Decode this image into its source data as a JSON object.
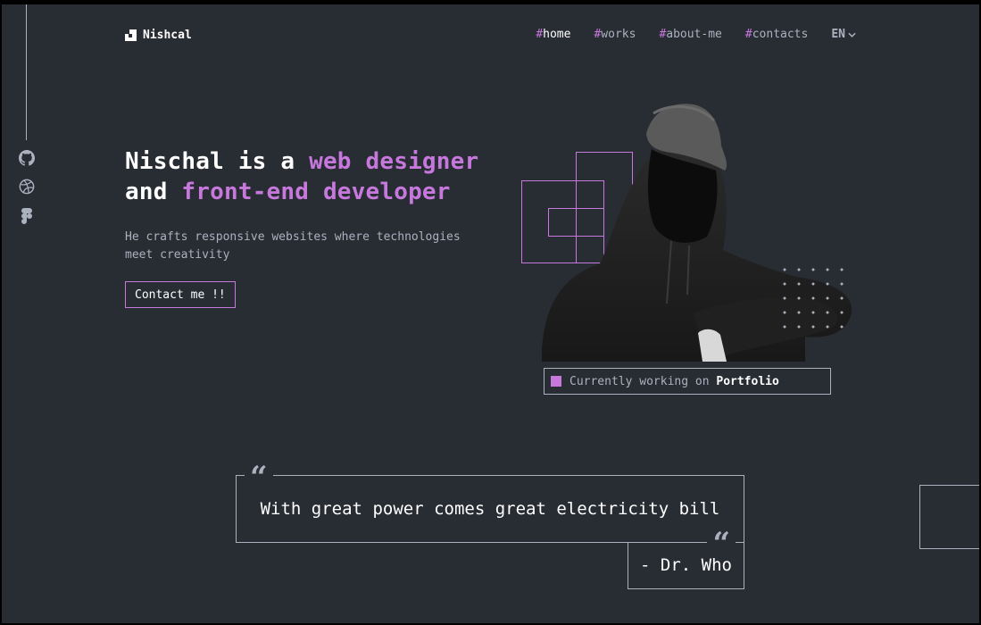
{
  "header": {
    "logo_name": "Nishcal",
    "nav": [
      {
        "hash": "#",
        "label": "home",
        "active": true
      },
      {
        "hash": "#",
        "label": "works"
      },
      {
        "hash": "#",
        "label": "about-me"
      },
      {
        "hash": "#",
        "label": "contacts"
      }
    ],
    "language": "EN"
  },
  "sidebar": {
    "socials": [
      "github-icon",
      "dribbble-icon",
      "figma-icon"
    ]
  },
  "hero": {
    "line1_plain": "Nischal is a ",
    "line1_accent": "web designer",
    "line2_plain": "and ",
    "line2_accent": "front-end developer",
    "subtitle": "He crafts responsive websites where technologies meet creativity",
    "cta_label": "Contact me !!",
    "status_prefix": "Currently working on ",
    "status_project": "Portfolio"
  },
  "quote": {
    "text": "With great power comes great electricity bill",
    "author": "- Dr. Who"
  },
  "colors": {
    "background": "#282c33",
    "accent": "#c778dd",
    "muted": "#abb2bf",
    "text": "#ffffff"
  }
}
